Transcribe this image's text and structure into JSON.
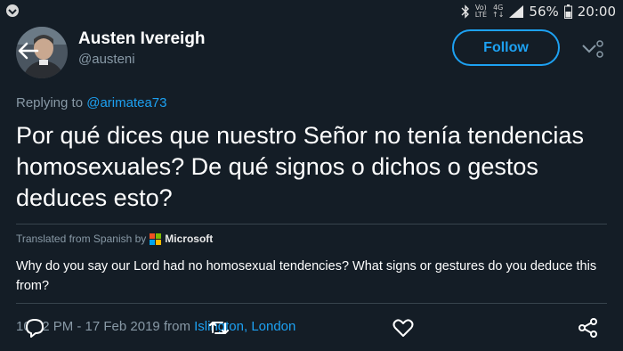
{
  "statusbar": {
    "network_top": "Vo)",
    "network_bottom": "LTE",
    "signal_top": "4G",
    "battery_percent": "56%",
    "time": "20:00"
  },
  "profile": {
    "name": "Austen Ivereigh",
    "handle": "@austeni",
    "follow_label": "Follow"
  },
  "tweet": {
    "replying_prefix": "Replying to ",
    "replying_handle": "@arimatea73",
    "text": "Por qué dices que nuestro Señor no tenía tendencias homosexuales? De qué signos o dichos o gestos deduces esto?",
    "translated_from": "Translated from Spanish by",
    "translator": "Microsoft",
    "translation": "Why do you say our Lord had no homosexual tendencies? What signs or gestures do you deduce this from?",
    "timestamp": "10:52 PM - 17 Feb 2019 from ",
    "location": "Islington, London"
  },
  "colors": {
    "background": "#141d26",
    "accent": "#1da1f2",
    "secondary_text": "#8899a6",
    "divider": "#38444d"
  },
  "icons": [
    "back-arrow-icon",
    "chevron-down-icon",
    "reply-icon",
    "retweet-icon",
    "like-icon",
    "share-icon"
  ]
}
